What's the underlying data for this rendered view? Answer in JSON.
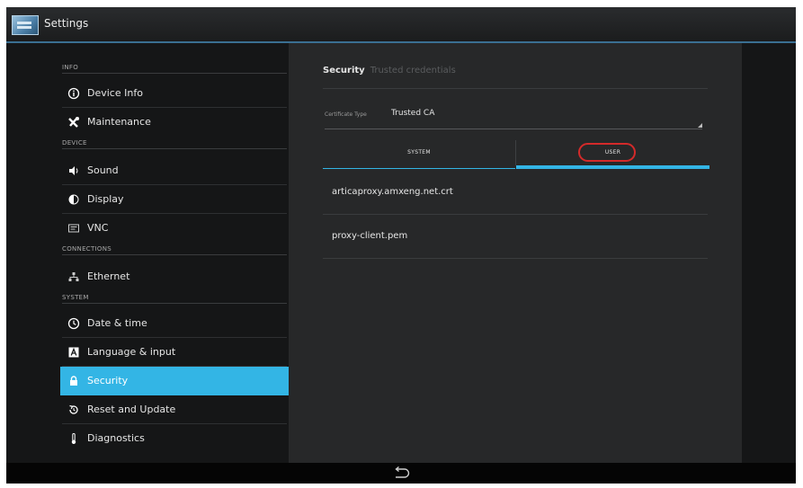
{
  "app": {
    "title": "Settings",
    "icon": "settings-app-icon"
  },
  "sidebar": {
    "headers": {
      "info": "INFO",
      "device": "DEVICE",
      "connections": "CONNECTIONS",
      "system": "SYSTEM"
    },
    "items": [
      {
        "label": "Device Info",
        "icon": "info-icon"
      },
      {
        "label": "Maintenance",
        "icon": "wrench-icon"
      },
      {
        "label": "Sound",
        "icon": "speaker-icon"
      },
      {
        "label": "Display",
        "icon": "brightness-icon"
      },
      {
        "label": "VNC",
        "icon": "vnc-icon"
      },
      {
        "label": "Ethernet",
        "icon": "ethernet-icon"
      },
      {
        "label": "Date & time",
        "icon": "clock-icon"
      },
      {
        "label": "Language & input",
        "icon": "keyboard-icon"
      },
      {
        "label": "Security",
        "icon": "lock-icon",
        "selected": true
      },
      {
        "label": "Reset and Update",
        "icon": "reset-icon"
      },
      {
        "label": "Diagnostics",
        "icon": "thermometer-icon"
      }
    ]
  },
  "content": {
    "breadcrumb": {
      "current": "Security",
      "sub": "Trusted credentials"
    },
    "certificate_type": {
      "label": "Certificate Type",
      "value": "Trusted CA"
    },
    "tabs": {
      "system": "SYSTEM",
      "user": "USER",
      "active": "USER"
    },
    "credentials": [
      "articaproxy.amxeng.net.crt",
      "proxy-client.pem"
    ]
  },
  "colors": {
    "accent": "#33b5e5",
    "highlight_circle": "#d42a2a"
  },
  "navbar": {
    "back_icon": "back-icon"
  }
}
